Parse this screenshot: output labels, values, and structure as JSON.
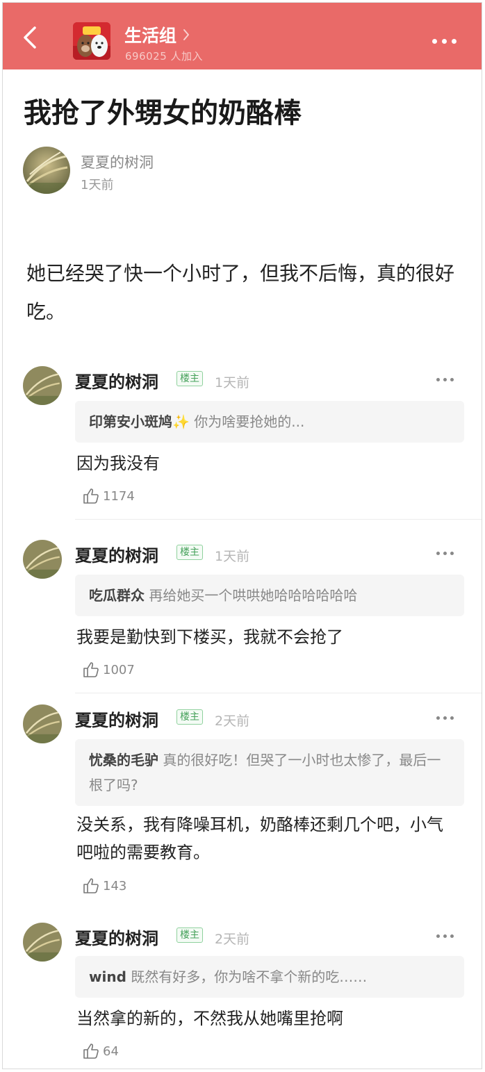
{
  "header": {
    "group_name": "生活组",
    "member_count": "696025 人加入"
  },
  "post": {
    "title": "我抢了外甥女的奶酪棒",
    "author": "夏夏的树洞",
    "time": "1天前",
    "body": "她已经哭了快一个小时了，但我不后悔，真的很好吃。"
  },
  "comments": [
    {
      "name": "夏夏的树洞",
      "badge": "楼主",
      "time": "1天前",
      "quote_name": "印第安小斑鸠",
      "quote_emoji": "✨",
      "quote_text": " 你为啥要抢她的...",
      "reply": "因为我没有",
      "likes": "1174"
    },
    {
      "name": "夏夏的树洞",
      "badge": "楼主",
      "time": "1天前",
      "quote_name": "吃瓜群众",
      "quote_text": " 再给她买一个哄哄她哈哈哈哈哈哈",
      "reply": "我要是勤快到下楼买，我就不会抢了",
      "likes": "1007"
    },
    {
      "name": "夏夏的树洞",
      "badge": "楼主",
      "time": "2天前",
      "quote_name": "忧桑的毛驴",
      "quote_text": " 真的很好吃！但哭了一小时也太惨了，最后一根了吗?",
      "reply": "没关系，我有降噪耳机，奶酪棒还剩几个吧，小气吧啦的需要教育。",
      "likes": "143"
    },
    {
      "name": "夏夏的树洞",
      "badge": "楼主",
      "time": "2天前",
      "quote_name": "wind",
      "quote_text": " 既然有好多，你为啥不拿个新的吃……",
      "reply": "当然拿的新的，不然我从她嘴里抢啊",
      "likes": "64"
    }
  ]
}
